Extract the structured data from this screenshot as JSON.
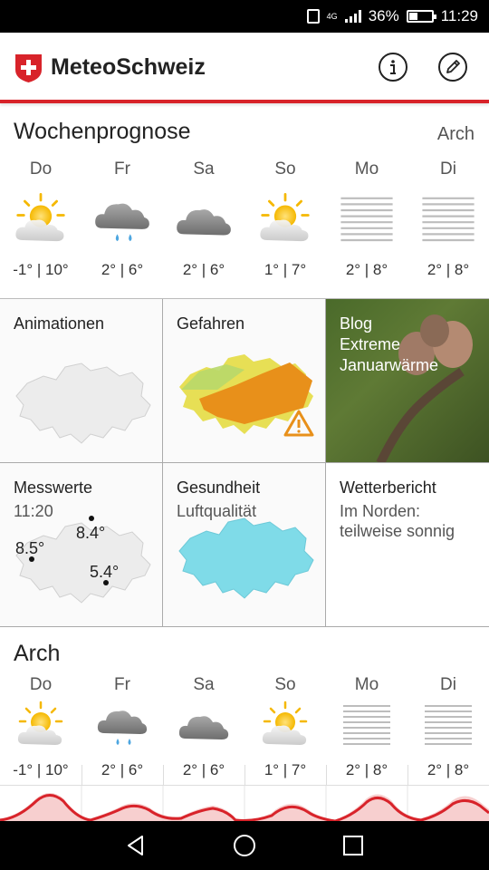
{
  "status_bar": {
    "network": "4G",
    "battery": "36%",
    "battery_level": 0.36,
    "time": "11:29"
  },
  "header": {
    "brand": "MeteoSchweiz",
    "info_icon": "info-icon",
    "edit_icon": "pencil-icon",
    "accent": "#d8232a"
  },
  "wochenprognose": {
    "title": "Wochenprognose",
    "location": "Arch",
    "days": [
      {
        "name": "Do",
        "temps": "-1° | 10°",
        "icon": "sun-cloud-icon"
      },
      {
        "name": "Fr",
        "temps": "2° | 6°",
        "icon": "rain-cloud-icon"
      },
      {
        "name": "Sa",
        "temps": "2° | 6°",
        "icon": "cloud-icon"
      },
      {
        "name": "So",
        "temps": "1° | 7°",
        "icon": "sun-cloud-icon"
      },
      {
        "name": "Mo",
        "temps": "2° | 8°",
        "icon": "fog-icon"
      },
      {
        "name": "Di",
        "temps": "2° | 8°",
        "icon": "fog-icon"
      }
    ]
  },
  "tiles": {
    "animationen": {
      "title": "Animationen"
    },
    "gefahren": {
      "title": "Gefahren"
    },
    "blog": {
      "line1": "Blog",
      "line2": "Extreme",
      "line3": "Januarwärme"
    },
    "messwerte": {
      "title": "Messwerte",
      "time": "11:20",
      "values": [
        "8.4°",
        "8.5°",
        "5.4°"
      ]
    },
    "gesundheit": {
      "title": "Gesundheit",
      "subtitle": "Luftqualität"
    },
    "wetterbericht": {
      "title": "Wetterbericht",
      "line1": "Im Norden:",
      "line2": "teilweise sonnig"
    }
  },
  "local_forecast": {
    "location": "Arch",
    "days": [
      {
        "name": "Do",
        "temps": "-1° | 10°",
        "icon": "sun-cloud-icon"
      },
      {
        "name": "Fr",
        "temps": "2° | 6°",
        "icon": "rain-cloud-icon"
      },
      {
        "name": "Sa",
        "temps": "2° | 6°",
        "icon": "cloud-icon"
      },
      {
        "name": "So",
        "temps": "1° | 7°",
        "icon": "sun-cloud-icon"
      },
      {
        "name": "Mo",
        "temps": "2° | 8°",
        "icon": "fog-icon"
      },
      {
        "name": "Di",
        "temps": "2° | 8°",
        "icon": "fog-icon"
      }
    ]
  },
  "nav": {
    "back_icon": "back-icon",
    "home_icon": "home-icon",
    "recents_icon": "recents-icon"
  }
}
